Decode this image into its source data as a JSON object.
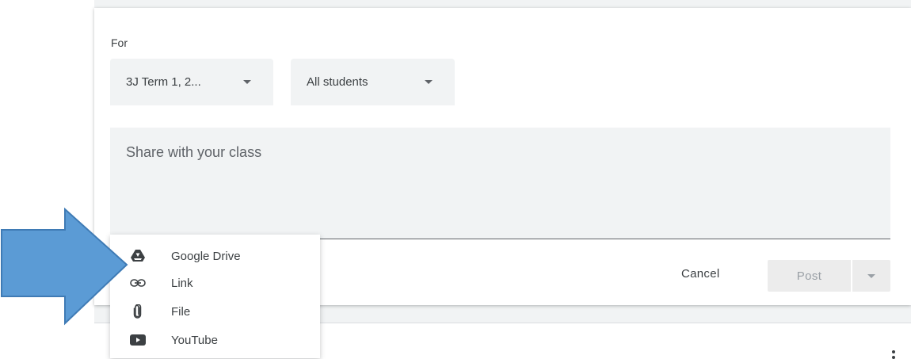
{
  "form": {
    "for_label": "For",
    "class_dropdown": "3J Term 1, 2...",
    "audience_dropdown": "All students",
    "share_placeholder": "Share with your class"
  },
  "actions": {
    "cancel_label": "Cancel",
    "post_label": "Post"
  },
  "attach_menu": {
    "items": [
      {
        "label": "Google Drive",
        "icon": "google-drive-icon"
      },
      {
        "label": "Link",
        "icon": "link-icon"
      },
      {
        "label": "File",
        "icon": "paperclip-icon"
      },
      {
        "label": "YouTube",
        "icon": "youtube-icon"
      }
    ]
  },
  "annotation": {
    "arrow_color": "#5b9bd5"
  }
}
